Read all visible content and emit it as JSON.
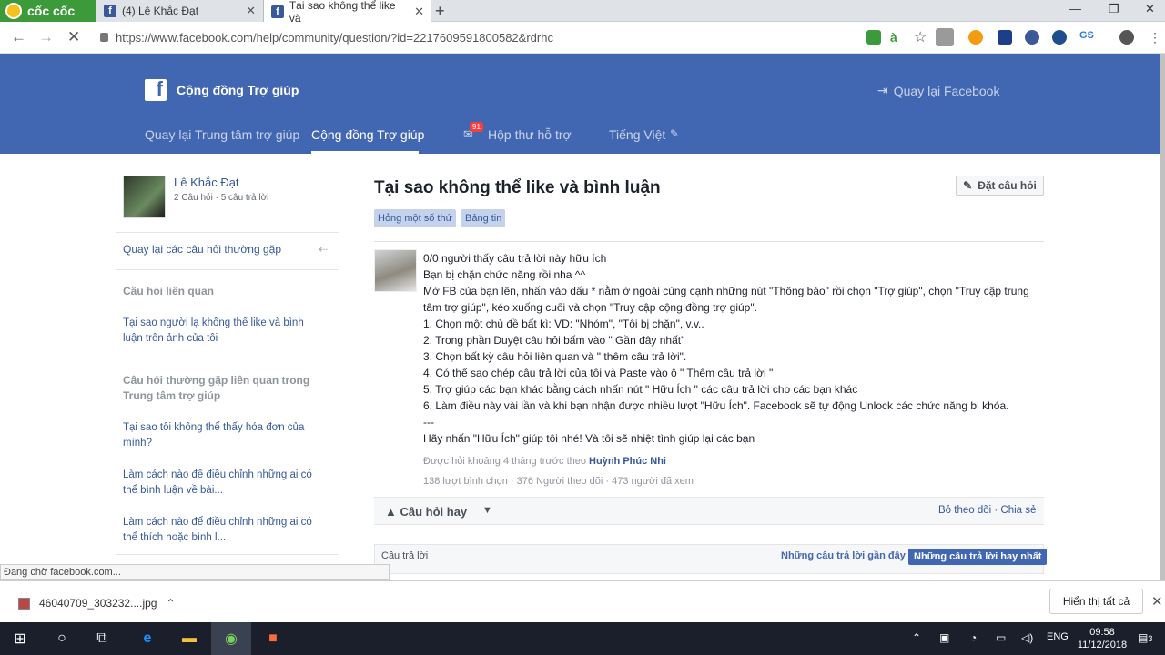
{
  "browser": {
    "brand": "cốc cốc",
    "tabs": [
      {
        "title": "(4) Lê Khắc Đạt"
      },
      {
        "title": "Tại sao không thể like và"
      }
    ],
    "new_tab": "+",
    "url": "https://www.facebook.com/help/community/question/?id=2217609591800582&rdrhc",
    "window_controls": [
      "—",
      "❐",
      "✕"
    ]
  },
  "header": {
    "logo": "f",
    "title": "Cộng đồng Trợ giúp",
    "back_to_facebook": "Quay lại Facebook",
    "nav": {
      "back_help_center": "Quay lại Trung tâm trợ giúp",
      "community": "Cộng đồng Trợ giúp",
      "inbox": "Hộp thư hỗ trợ",
      "inbox_badge": "91",
      "language": "Tiếng Việt"
    }
  },
  "sidebar": {
    "user_name": "Lê Khắc Đạt",
    "user_stats": "2 Câu hỏi · 5 câu trả lời",
    "back_faq": "Quay lại các câu hỏi thường gặp",
    "related_heading": "Câu hỏi liên quan",
    "related": [
      "Tại sao người lạ không thể like và bình luận trên ảnh của tôi"
    ],
    "faq_heading": "Câu hỏi thường gặp liên quan trong Trung tâm trợ giúp",
    "faq": [
      "Tại sao tôi không thể thấy hóa đơn của mình?",
      "Làm cách nào để điều chỉnh những ai có thể bình luận về bài...",
      "Làm cách nào để điều chỉnh những ai có thể thích hoặc bình l..."
    ]
  },
  "question": {
    "title": "Tại sao không thể like và bình luận",
    "ask_button": "Đặt câu hỏi",
    "tags": [
      "Hỏng một số thứ",
      "Bảng tin"
    ],
    "answer_lines": [
      "0/0 người thấy câu trả lời này hữu ích",
      "Bạn bị chặn chức năng rồi nha ^^",
      "Mở FB của bạn lên, nhấn vào dấu * nằm ở ngoài cùng cạnh những nút \"Thông báo\" rồi chọn \"Trợ giúp\", chọn \"Truy cập trung",
      "tâm trợ giúp\", kéo xuống cuối và chọn \"Truy cập cộng đồng trợ giúp\".",
      "1. Chọn một chủ đề bất kì: VD: \"Nhóm\", \"Tôi bị chặn\", v.v..",
      "2. Trong phần Duyệt câu hỏi bấm vào \" Gần đây nhất\"",
      "3. Chọn bất kỳ câu hỏi liên quan và \" thêm câu trả lời\".",
      "4. Có thể sao chép câu trả lời của tôi và Paste vào ô \" Thêm câu trả lời \"",
      "5. Trợ giúp các bạn khác bằng cách nhấn nút \" Hữu Ích \" các câu trả lời cho các bạn khác",
      "6. Làm điều này vài lần và khi bạn nhận được nhiều lượt \"Hữu Ích\". Facebook sẽ tự động Unlock các chức năng bị khóa.",
      "---",
      "Hãy nhấn \"Hữu Ích\" giúp tôi nhé! Và tôi sẽ nhiệt tình giúp lại các bạn"
    ],
    "asked_prefix": "Được hỏi khoảng 4 tháng trước theo",
    "asked_by": "Huỳnh Phúc Nhi",
    "stats": "138 lượt bình chọn · 376 Người theo dõi · 473 người đã xem",
    "good_question": "Câu hỏi hay",
    "actions_right": "Bỏ theo dõi · Chia sẻ",
    "answers_label": "Câu trả lời",
    "recent_answers": "Những câu trả lời gần đây",
    "best_answers": "Những câu trả lời hay nhất"
  },
  "status_text": "Đang chờ facebook.com...",
  "download": {
    "file": "46040709_303232....jpg",
    "show_all": "Hiển thị tất cả"
  },
  "taskbar": {
    "lang": "ENG",
    "time": "09:58",
    "date": "11/12/2018",
    "notif": "3"
  },
  "colors": {
    "fb_blue": "#4267b2",
    "link": "#365899"
  }
}
